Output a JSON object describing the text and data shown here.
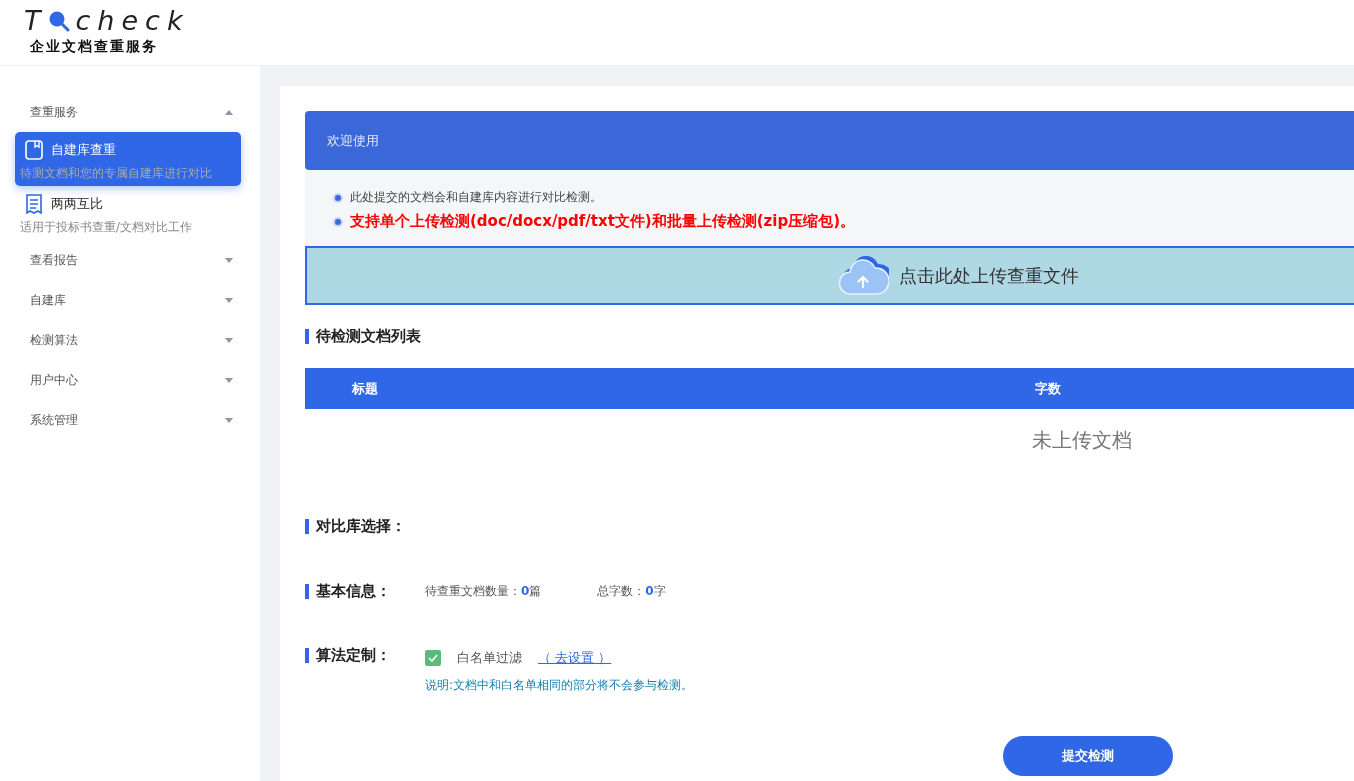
{
  "logo": {
    "lead": "T",
    "rest": "check",
    "subtitle": "企业文档查重服务"
  },
  "sidebar": {
    "sections": [
      {
        "label": "查重服务",
        "expanded": true,
        "children": [
          {
            "label": "自建库查重",
            "description": "待测文档和您的专属自建库进行对比",
            "selected": true,
            "kind": "book"
          },
          {
            "label": "两两互比",
            "description": "适用于投标书查重/文档对比工作",
            "selected": false,
            "kind": "receipt"
          }
        ]
      },
      {
        "label": "查看报告",
        "expanded": false
      },
      {
        "label": "自建库",
        "expanded": false
      },
      {
        "label": "检测算法",
        "expanded": false
      },
      {
        "label": "用户中心",
        "expanded": false
      },
      {
        "label": "系统管理",
        "expanded": false
      }
    ]
  },
  "banner": {
    "title": "欢迎使用"
  },
  "notices": [
    {
      "text": "此处提交的文档会和自建库内容进行对比检测。",
      "emphasis": false
    },
    {
      "text": "支持单个上传检测(doc/docx/pdf/txt文件)和批量上传检测(zip压缩包)。",
      "emphasis": true
    }
  ],
  "upload": {
    "label": "点击此处上传查重文件"
  },
  "doc_list": {
    "title": "待检测文档列表",
    "columns": [
      "标题",
      "字数"
    ],
    "empty_text": "未上传文档"
  },
  "compare": {
    "label": "对比库选择："
  },
  "basic_info": {
    "label": "基本信息：",
    "stats": [
      {
        "label": "待查重文档数量：",
        "value": "0",
        "unit": "篇"
      },
      {
        "label": "总字数：",
        "value": "0",
        "unit": "字"
      }
    ]
  },
  "algorithm": {
    "label": "算法定制：",
    "option": {
      "label": "白名单过滤",
      "checked": true
    },
    "link": "（ 去设置 ）",
    "note": "说明:文档中和白名单相同的部分将不会参与检测。"
  },
  "submit": {
    "label": "提交检测"
  }
}
